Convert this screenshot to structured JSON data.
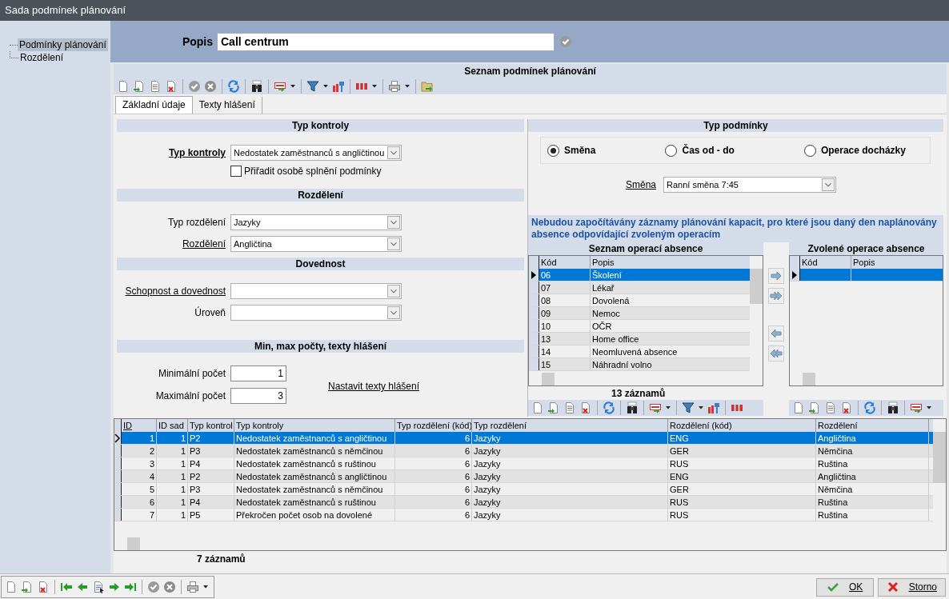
{
  "window": {
    "title": "Sada podmínek plánování"
  },
  "sidebar": {
    "items": [
      {
        "label": "Podmínky plánování",
        "selected": true
      },
      {
        "label": "Rozdělení",
        "selected": false
      }
    ]
  },
  "description": {
    "label": "Popis",
    "value": "Call centrum"
  },
  "panel": {
    "title": "Seznam podmínek plánování"
  },
  "tabs": [
    {
      "label": "Základní údaje",
      "selected": true
    },
    {
      "label": "Texty hlášení",
      "selected": false
    }
  ],
  "check_type": {
    "heading": "Typ kontroly",
    "label": "Typ kontroly",
    "value": "Nedostatek zaměstnanců s angličtinou",
    "assign": {
      "label": "Přiřadit osobě splnění podmínky",
      "checked": false
    }
  },
  "distribution": {
    "heading": "Rozdělení",
    "fields": [
      {
        "label": "Typ rozdělení",
        "value": "Jazyky",
        "link": false
      },
      {
        "label": "Rozdělení",
        "value": "Angličtina",
        "link": true
      }
    ]
  },
  "skill": {
    "heading": "Dovednost",
    "fields": [
      {
        "label": "Schopnost a dovednost",
        "link": true
      },
      {
        "label": "Úroveň",
        "link": false
      }
    ]
  },
  "counts": {
    "heading": "Min, max počty, texty hlášení",
    "fields": [
      {
        "label": "Minimální počet",
        "value": "1"
      },
      {
        "label": "Maximální počet",
        "value": "3"
      }
    ],
    "link": "Nastavit texty hlášení"
  },
  "condition_type": {
    "heading": "Typ podmínky",
    "options": [
      {
        "label": "Směna",
        "selected": true
      },
      {
        "label": "Čas od - do",
        "selected": false
      },
      {
        "label": "Operace docházky",
        "selected": false
      }
    ],
    "shift": {
      "label": "Směna",
      "value": "Ranní směna 7:45"
    }
  },
  "absence": {
    "note": "Nebudou započítávány záznamy plánování kapacit, pro které jsou daný den naplánovány absence odpovídající zvoleným operacím",
    "available": {
      "title": "Seznam operací absence",
      "columns": [
        "Kód",
        "Popis"
      ],
      "rows": [
        {
          "code": "06",
          "description": "Školení",
          "selected": true
        },
        {
          "code": "07",
          "description": "Lékař",
          "selected": false
        },
        {
          "code": "08",
          "description": "Dovolená",
          "selected": false
        },
        {
          "code": "09",
          "description": "Nemoc",
          "selected": false
        },
        {
          "code": "10",
          "description": "OČR",
          "selected": false
        },
        {
          "code": "13",
          "description": "Home office",
          "selected": false
        },
        {
          "code": "14",
          "description": "Neomluvená absence",
          "selected": false
        },
        {
          "code": "15",
          "description": "Náhradní volno",
          "selected": false
        }
      ],
      "count": "13 záznamů"
    },
    "chosen": {
      "title": "Zvolené operace absence",
      "columns": [
        "Kód",
        "Popis"
      ],
      "rows": [
        {
          "selected": true
        }
      ]
    }
  },
  "table": {
    "columns": [
      {
        "label": "ID",
        "sorted": true
      },
      {
        "label": "ID sad",
        "sorted": false
      },
      {
        "label": "Typ kontrol",
        "sorted": false
      },
      {
        "label": "Typ kontroly",
        "sorted": false
      },
      {
        "label": "Typ rozdělení (kód)",
        "sorted": false
      },
      {
        "label": "Typ rozdělení",
        "sorted": false
      },
      {
        "label": "Rozdělení (kód)",
        "sorted": false
      },
      {
        "label": "Rozdělení",
        "sorted": false
      }
    ],
    "rows": [
      {
        "cells": [
          "1",
          "1",
          "P2",
          "Nedostatek zaměstnanců s angličtinou",
          "6",
          "Jazyky",
          "ENG",
          "Angličtina"
        ],
        "selected": true
      },
      {
        "cells": [
          "2",
          "1",
          "P3",
          "Nedostatek zaměstnanců s němčinou",
          "6",
          "Jazyky",
          "GER",
          "Němčina"
        ],
        "selected": false
      },
      {
        "cells": [
          "3",
          "1",
          "P4",
          "Nedostatek zaměstnanců s ruštinou",
          "6",
          "Jazyky",
          "RUS",
          "Ruština"
        ],
        "selected": false
      },
      {
        "cells": [
          "4",
          "1",
          "P2",
          "Nedostatek zaměstnanců s angličtinou",
          "6",
          "Jazyky",
          "ENG",
          "Angličtina"
        ],
        "selected": false
      },
      {
        "cells": [
          "5",
          "1",
          "P3",
          "Nedostatek zaměstnanců s němčinou",
          "6",
          "Jazyky",
          "GER",
          "Němčina"
        ],
        "selected": false
      },
      {
        "cells": [
          "6",
          "1",
          "P4",
          "Nedostatek zaměstnanců s ruštinou",
          "6",
          "Jazyky",
          "RUS",
          "Ruština"
        ],
        "selected": false
      },
      {
        "cells": [
          "7",
          "1",
          "P5",
          "Překročen počet osob na dovolené",
          "6",
          "Jazyky",
          "RUS",
          "Ruština"
        ],
        "selected": false
      }
    ],
    "count": "7 záznamů"
  },
  "buttons": [
    {
      "label": "OK",
      "kind": "ok"
    },
    {
      "label": "Storno",
      "kind": "cancel"
    }
  ]
}
